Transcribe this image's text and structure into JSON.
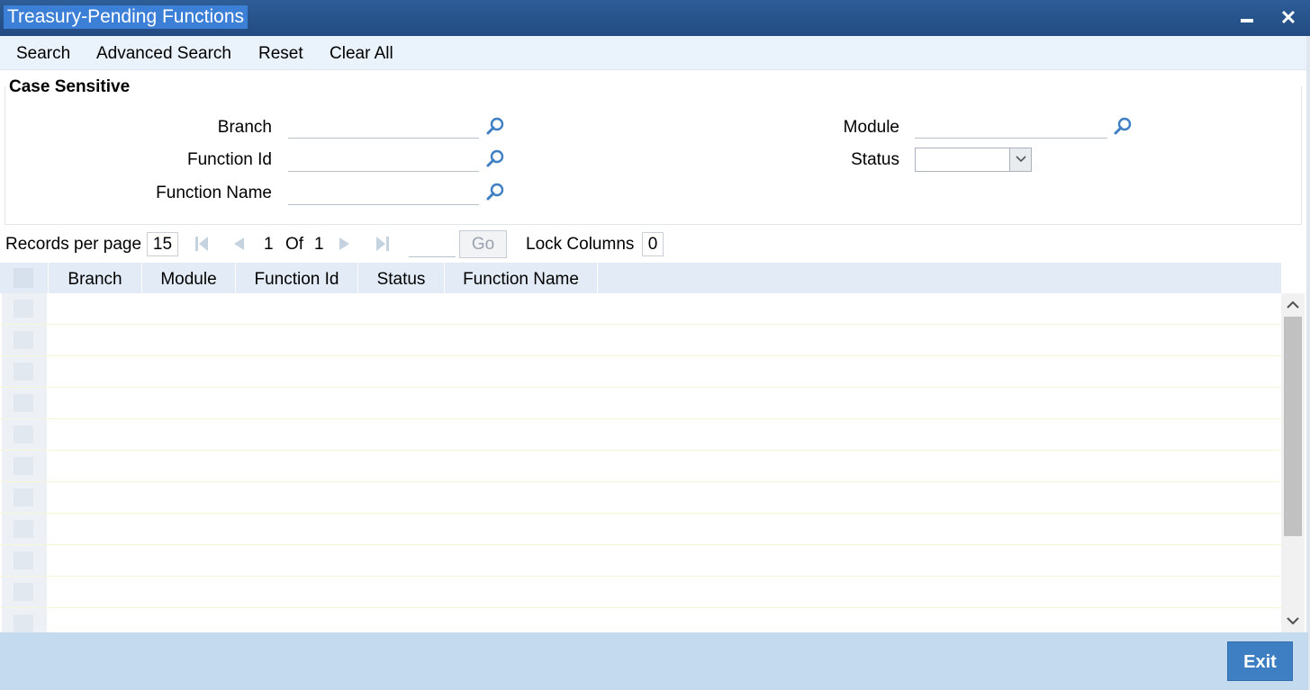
{
  "window": {
    "title": "Treasury-Pending Functions",
    "minimize_icon": "minimize-icon",
    "close_icon": "close-icon",
    "close_glyph": "✕"
  },
  "toolbar": {
    "search": "Search",
    "advanced_search": "Advanced Search",
    "reset": "Reset",
    "clear_all": "Clear All"
  },
  "criteria": {
    "section_title": "Case Sensitive",
    "branch_label": "Branch",
    "branch_value": "",
    "function_id_label": "Function Id",
    "function_id_value": "",
    "function_name_label": "Function Name",
    "function_name_value": "",
    "module_label": "Module",
    "module_value": "",
    "status_label": "Status",
    "status_value": ""
  },
  "pagination": {
    "records_per_page_label": "Records per page",
    "records_per_page": "15",
    "current_page": "1",
    "of_label": "Of",
    "total_pages": "1",
    "go_label": "Go",
    "lock_columns_label": "Lock Columns",
    "lock_columns": "0"
  },
  "grid": {
    "columns": [
      "Branch",
      "Module",
      "Function Id",
      "Status",
      "Function Name"
    ],
    "rows": []
  },
  "footer": {
    "exit_label": "Exit"
  },
  "colors": {
    "title_bar": "#2e5d97",
    "title_highlight": "#3c7fd6",
    "toolbar_bg": "#eaf2fb",
    "grid_header": "#e3ebf6",
    "footer_bg": "#c4daee",
    "exit_button": "#3d7fc2",
    "lookup_icon": "#3d7fc2"
  }
}
